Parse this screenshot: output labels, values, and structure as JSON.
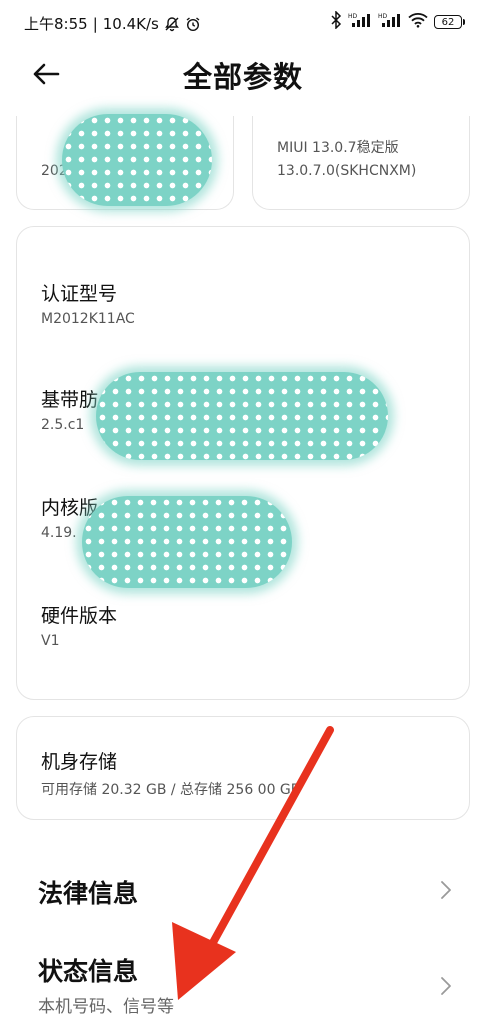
{
  "status_bar": {
    "time": "上午8:55",
    "speed": "10.4K/s",
    "battery": "62"
  },
  "header": {
    "title": "全部参数"
  },
  "top_cards": {
    "left_partial": "202",
    "right_line1": "MIUI 13.0.7稳定版",
    "right_line2": "13.0.7.0(SKHCNXM)"
  },
  "info_card": {
    "items": [
      {
        "label": "认证型号",
        "value": "M2012K11AC"
      },
      {
        "label": "基带版本",
        "label_visible": "基带肪",
        "value_visible": "2.5.c1"
      },
      {
        "label": "内核版本",
        "label_visible": "内核版",
        "value_visible": "4.19."
      },
      {
        "label": "硬件版本",
        "value": "V1"
      }
    ]
  },
  "storage_card": {
    "label": "机身存储",
    "value": "可用存储 20.32 GB / 总存储 256.00 GB",
    "value_visible": "可用存储 20.32 GB / 总存储 256  00 GB"
  },
  "list": [
    {
      "title": "法律信息",
      "subtitle": ""
    },
    {
      "title": "状态信息",
      "subtitle": "本机号码、信号等"
    }
  ],
  "annotation": {
    "arrow_color": "#e8321e"
  },
  "colors": {
    "blob": "#7dd3c6"
  }
}
